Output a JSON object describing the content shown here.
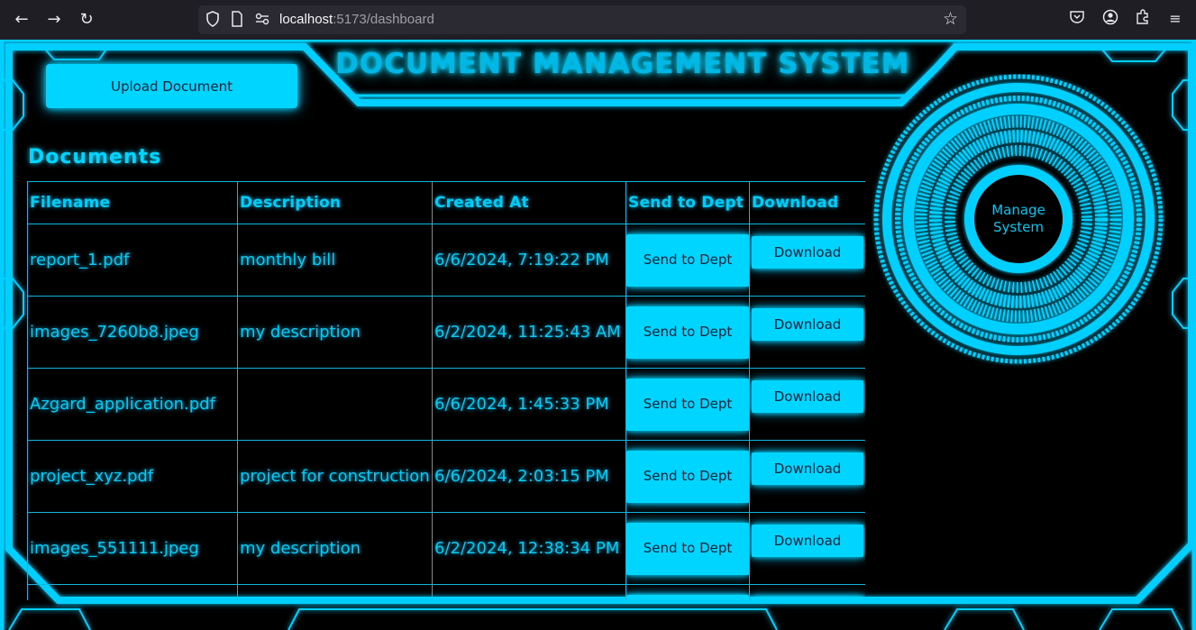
{
  "browser": {
    "url_host": "localhost",
    "url_path": ":5173/dashboard",
    "icons": [
      "back-icon",
      "forward-icon",
      "reload-icon",
      "shield-icon",
      "page-icon",
      "permissions-icon",
      "bookmark-star-icon",
      "pocket-icon",
      "account-icon",
      "extensions-icon",
      "menu-icon"
    ]
  },
  "app": {
    "title": "DOCUMENT MANAGEMENT SYSTEM",
    "upload_label": "Upload Document",
    "documents_heading": "Documents",
    "manage_label": "Manage System",
    "accent_color": "#00d5ff"
  },
  "table": {
    "headers": {
      "filename": "Filename",
      "description": "Description",
      "created": "Created At",
      "send": "Send to Dept",
      "download": "Download"
    },
    "rows": [
      {
        "filename": "report_1.pdf",
        "description": "monthly bill",
        "created": "6/6/2024, 7:19:22 PM",
        "send": "Send to Dept",
        "download": "Download"
      },
      {
        "filename": "images_7260b8.jpeg",
        "description": "my description",
        "created": "6/2/2024, 11:25:43 AM",
        "send": "Send to Dept",
        "download": "Download"
      },
      {
        "filename": "Azgard_application.pdf",
        "description": "",
        "created": "6/6/2024, 1:45:33 PM",
        "send": "Send to Dept",
        "download": "Download"
      },
      {
        "filename": "project_xyz.pdf",
        "description": "project for construction",
        "created": "6/6/2024, 2:03:15 PM",
        "send": "Send to Dept",
        "download": "Download"
      },
      {
        "filename": "images_551111.jpeg",
        "description": "my description",
        "created": "6/2/2024, 12:38:34 PM",
        "send": "Send to Dept",
        "download": "Download"
      }
    ]
  }
}
